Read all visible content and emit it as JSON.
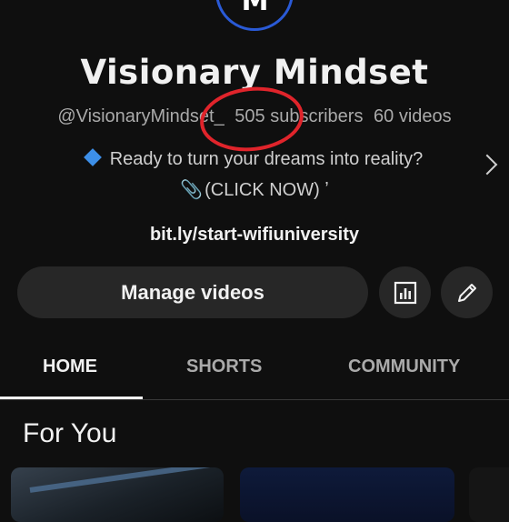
{
  "channel": {
    "avatar_mark": "M",
    "name": "Visionary Mindset",
    "handle": "@VisionaryMindset_",
    "subscribers": "505 subscribers",
    "videos": "60 videos",
    "description_line1": "Ready to turn your dreams into reality?",
    "description_line2": "(CLICK NOW) ʼ",
    "link": "bit.ly/start-wifiuniversity"
  },
  "actions": {
    "manage_label": "Manage videos",
    "analytics_icon": "analytics-icon",
    "edit_icon": "pencil-icon"
  },
  "tabs": [
    {
      "label": "HOME",
      "active": true
    },
    {
      "label": "SHORTS",
      "active": false
    },
    {
      "label": "COMMUNITY",
      "active": false
    }
  ],
  "section": {
    "title": "For You"
  },
  "colors": {
    "background": "#0f0f0f",
    "button": "#272727",
    "annotation": "#e0242b",
    "avatar_ring": "#2a5ad6"
  }
}
